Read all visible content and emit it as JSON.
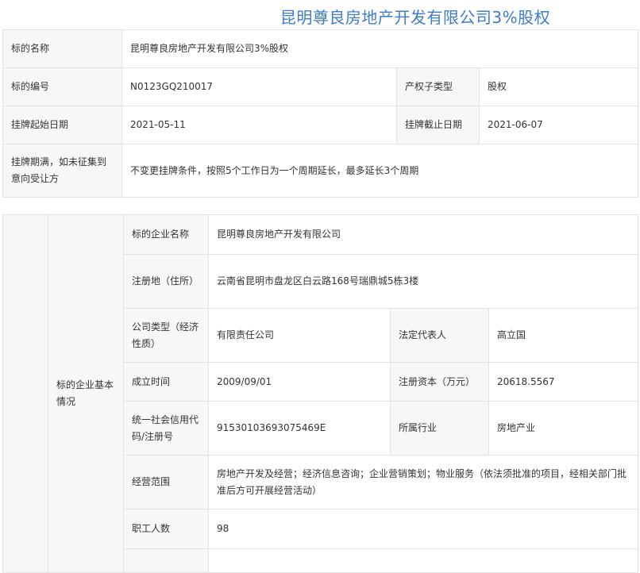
{
  "title": "昆明尊良房地产开发有限公司3%股权",
  "listing": {
    "name_label": "标的名称",
    "name_value": "昆明尊良房地产开发有限公司3%股权",
    "code_label": "标的编号",
    "code_value": "N0123GQ210017",
    "subtype_label": "产权子类型",
    "subtype_value": "股权",
    "start_label": "挂牌起始日期",
    "start_value": "2021-05-11",
    "end_label": "挂牌截止日期",
    "end_value": "2021-06-07",
    "expiry_label": "挂牌期满，如未征集到意向受让方",
    "expiry_value": "不变更挂牌条件，按照5个工作日为一个周期延长，最多延长3个周期"
  },
  "company": {
    "section_label": "标的企业基本情况",
    "name_label": "标的企业名称",
    "name_value": "昆明尊良房地产开发有限公司",
    "address_label": "注册地（住所）",
    "address_value": "云南省昆明市盘龙区白云路168号瑞鼎城5栋3楼",
    "type_label": "公司类型（经济性质）",
    "type_value": "有限责任公司",
    "rep_label": "法定代表人",
    "rep_value": "高立国",
    "founded_label": "成立时间",
    "founded_value": "2009/09/01",
    "capital_label": "注册资本（万元）",
    "capital_value": "20618.5567",
    "credit_label": "统一社会信用代码/注册号",
    "credit_value": "91530103693075469E",
    "industry_label": "所属行业",
    "industry_value": "房地产业",
    "scope_label": "经营范围",
    "scope_value": "房地产开发及经营；经济信息咨询；企业营销策划；物业服务（依法须批准的项目，经相关部门批准后方可开展经营活动）",
    "staff_label": "职工人数",
    "staff_value": "98"
  }
}
